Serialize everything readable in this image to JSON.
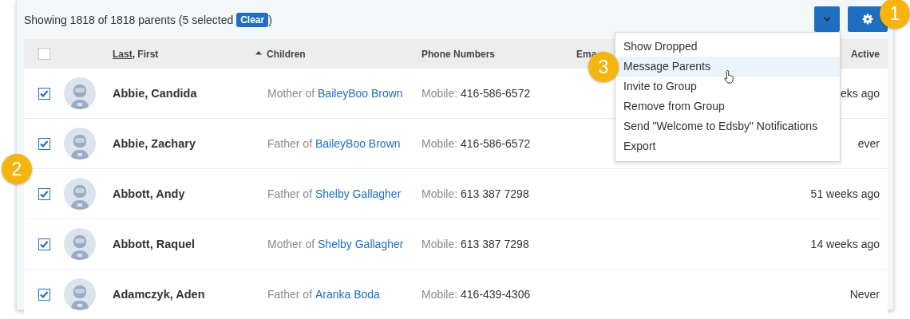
{
  "summary": {
    "text": "Showing 1818 of 1818 parents (5 selected",
    "clear": "Clear",
    "close": ")"
  },
  "toolbar": {
    "dropdown_open": true
  },
  "columns": {
    "select_all": {
      "checked": false
    },
    "name_sort": "Last",
    "name_rest": ", First",
    "children": "Children",
    "children_sorted": true,
    "phone": "Phone Numbers",
    "email": "Ema",
    "active": "Active"
  },
  "rows": [
    {
      "checked": true,
      "name": "Abbie, Candida",
      "relation": "Mother of",
      "child": "BaileyBoo Brown",
      "phone_label": "Mobile:",
      "phone": "416-586-6572",
      "active": "eks ago"
    },
    {
      "checked": true,
      "name": "Abbie, Zachary",
      "relation": "Father of",
      "child": "BaileyBoo Brown",
      "phone_label": "Mobile:",
      "phone": "416-586-6572",
      "active": "ever"
    },
    {
      "checked": true,
      "name": "Abbott, Andy",
      "relation": "Father of",
      "child": "Shelby Gallagher",
      "phone_label": "Mobile:",
      "phone": "613 387 7298",
      "active": "51 weeks ago"
    },
    {
      "checked": true,
      "name": "Abbott, Raquel",
      "relation": "Mother of",
      "child": "Shelby Gallagher",
      "phone_label": "Mobile:",
      "phone": "613 387 7298",
      "active": "14 weeks ago"
    },
    {
      "checked": true,
      "name": "Adamczyk, Aden",
      "relation": "Father of",
      "child": "Aranka Boda",
      "phone_label": "Mobile:",
      "phone": "416-439-4306",
      "active": "Never"
    }
  ],
  "menu": [
    {
      "label": "Show Dropped",
      "selected": false
    },
    {
      "label": "Message Parents",
      "selected": true
    },
    {
      "label": "Invite to Group",
      "selected": false
    },
    {
      "label": "Remove from Group",
      "selected": false
    },
    {
      "label": "Send \"Welcome to Edsby\" Notifications",
      "selected": false
    },
    {
      "label": "Export",
      "selected": false
    }
  ],
  "callouts": [
    "1",
    "2",
    "3"
  ]
}
